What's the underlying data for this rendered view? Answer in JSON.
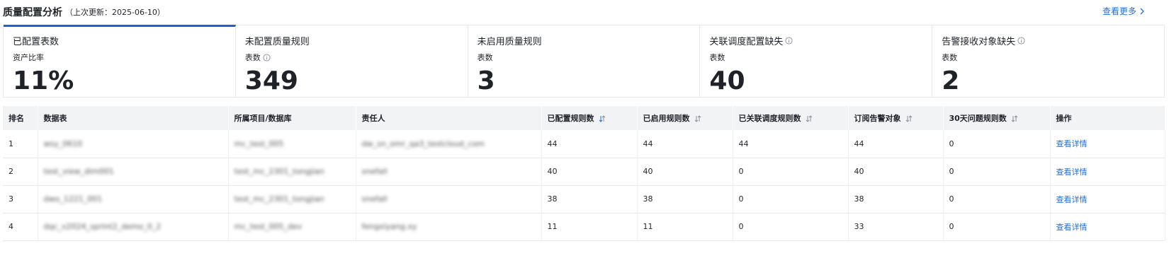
{
  "header": {
    "title": "质量配置分析",
    "subtitle": "（上次更新：2025-06-10）",
    "more_label": "查看更多"
  },
  "cards": [
    {
      "title": "已配置表数",
      "sub": "资产比率",
      "value": "11%"
    },
    {
      "title": "未配置质量规则",
      "sub": "表数",
      "value": "349"
    },
    {
      "title": "未启用质量规则",
      "sub": "表数",
      "value": "3"
    },
    {
      "title": "关联调度配置缺失",
      "sub": "表数",
      "value": "40"
    },
    {
      "title": "告警接收对象缺失",
      "sub": "表数",
      "value": "2"
    }
  ],
  "table": {
    "columns": [
      "排名",
      "数据表",
      "所属项目/数据库",
      "责任人",
      "已配置规则数",
      "已启用规则数",
      "已关联调度规则数",
      "订阅告警对象",
      "30天问题规则数",
      "操作"
    ],
    "rows": [
      {
        "rank": "1",
        "table": "wsy_0610",
        "project": "mc_test_005",
        "owner": "dw_sn_omr_qa3_testcloud_com",
        "configured": "44",
        "enabled": "44",
        "scheduled": "44",
        "alert": "44",
        "issues": "0",
        "action": "查看详情"
      },
      {
        "rank": "2",
        "table": "test_view_dim001",
        "project": "test_mc_2301_tongjian",
        "owner": "snefall",
        "configured": "40",
        "enabled": "40",
        "scheduled": "0",
        "alert": "40",
        "issues": "0",
        "action": "查看详情"
      },
      {
        "rank": "3",
        "table": "dwo_1221_001",
        "project": "test_mc_2301_tongjian",
        "owner": "snefall",
        "configured": "38",
        "enabled": "38",
        "scheduled": "0",
        "alert": "38",
        "issues": "0",
        "action": "查看详情"
      },
      {
        "rank": "4",
        "table": "dqc_v2024_sprint2_demo_0_2",
        "project": "mc_test_005_dev",
        "owner": "fengxiyang.xy",
        "configured": "11",
        "enabled": "11",
        "scheduled": "0",
        "alert": "33",
        "issues": "0",
        "action": "查看详情"
      }
    ]
  },
  "colors": {
    "accent": "#1f5fd6",
    "link": "#1f6fe0",
    "header_bg": "#f2f3f5"
  },
  "icons": {
    "more": "chevron-right-icon",
    "info": "info-circle-icon",
    "sort": "sort-icon"
  }
}
